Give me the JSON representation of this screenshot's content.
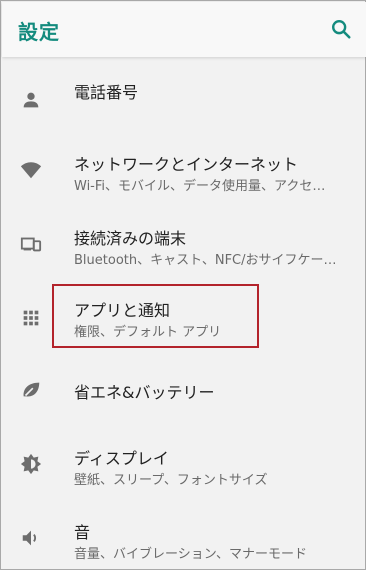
{
  "appbar": {
    "title": "設定",
    "search_icon": "search-icon",
    "accent_color": "#148b7e"
  },
  "items": [
    {
      "label": "電話番号",
      "sub": "",
      "icon": "person-icon"
    },
    {
      "label": "ネットワークとインターネット",
      "sub": "Wi-Fi、モバイル、データ使用量、アクセ…",
      "icon": "wifi-icon"
    },
    {
      "label": "接続済みの端末",
      "sub": "Bluetooth、キャスト、NFC/おサイフケー…",
      "icon": "devices-icon"
    },
    {
      "label": "アプリと通知",
      "sub": "権限、デフォルト アプリ",
      "icon": "apps-grid-icon"
    },
    {
      "label": "省エネ&バッテリー",
      "sub": "",
      "icon": "eco-leaf-icon"
    },
    {
      "label": "ディスプレイ",
      "sub": "壁紙、スリープ、フォントサイズ",
      "icon": "brightness-icon"
    },
    {
      "label": "音",
      "sub": "音量、バイブレーション、マナーモード",
      "icon": "volume-icon"
    }
  ],
  "highlight_color": "#b3232b"
}
